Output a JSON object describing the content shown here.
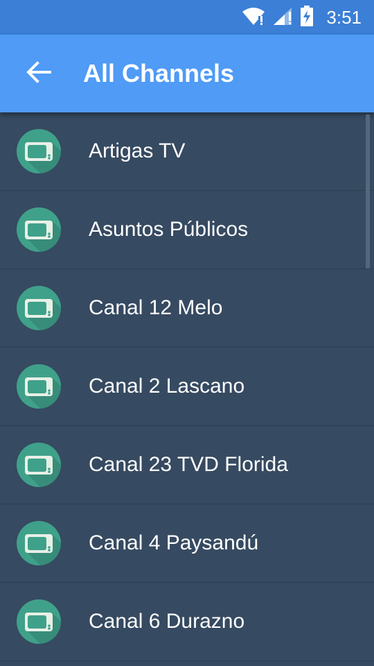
{
  "status_bar": {
    "time": "3:51",
    "icons": [
      "wifi-icon",
      "signal-icon",
      "battery-charging-icon"
    ]
  },
  "app_bar": {
    "title": "All Channels",
    "back_icon": "arrow-back-icon"
  },
  "channels": [
    {
      "label": "Artigas TV",
      "icon": "tv-icon"
    },
    {
      "label": "Asuntos Públicos",
      "icon": "tv-icon"
    },
    {
      "label": "Canal 12 Melo",
      "icon": "tv-icon"
    },
    {
      "label": "Canal 2 Lascano",
      "icon": "tv-icon"
    },
    {
      "label": "Canal 23 TVD Florida",
      "icon": "tv-icon"
    },
    {
      "label": "Canal 4 Paysandú",
      "icon": "tv-icon"
    },
    {
      "label": "Canal 6 Durazno",
      "icon": "tv-icon"
    }
  ],
  "colors": {
    "status_bar": "#3b7fd6",
    "app_bar": "#4f9bf5",
    "list_background": "#364a61",
    "avatar": "#3fa18a",
    "tv_screen": "#3fa18a",
    "tv_body": "#e8f0e6"
  }
}
